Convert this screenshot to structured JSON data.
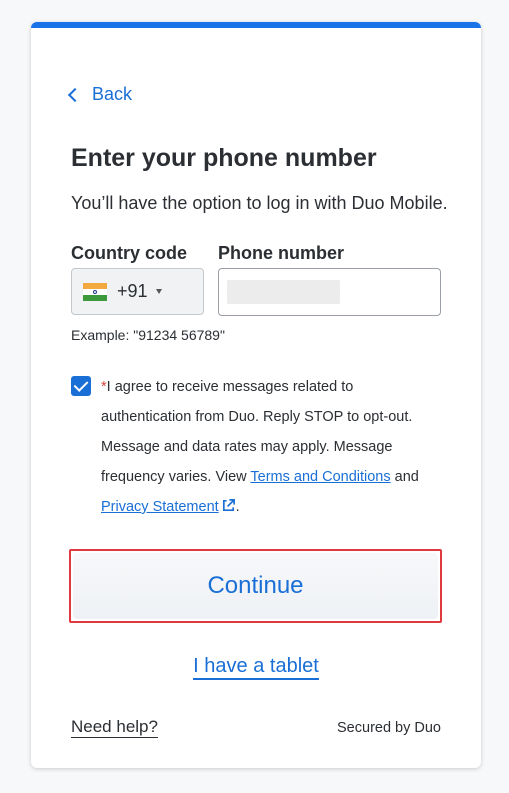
{
  "colors": {
    "accent": "#1a6fd6",
    "top_bar": "#1a73e8",
    "required_asterisk": "#d6453d",
    "highlight_border": "#e0393e"
  },
  "nav": {
    "back_label": "Back",
    "back_icon": "chevron-left-icon"
  },
  "header": {
    "title": "Enter your phone number",
    "subtitle": "You’ll have the option to log in with Duo Mobile."
  },
  "form": {
    "country_label": "Country code",
    "country_flag": "india-flag-icon",
    "country_dial_code": "+91",
    "phone_label": "Phone number",
    "phone_value": "",
    "example": "Example: \"91234 56789\""
  },
  "consent": {
    "checked": true,
    "asterisk": "*",
    "text_1": "I agree to receive messages related to authentication from Duo. Reply STOP to opt-out. Message and data rates may apply. Message frequency varies. View ",
    "terms_link": "Terms and Conditions",
    "text_2": " and ",
    "privacy_link": "Privacy Statement",
    "text_3": "."
  },
  "actions": {
    "continue_label": "Continue",
    "tablet_label": "I have a tablet"
  },
  "footer": {
    "help_label": "Need help?",
    "secured_label": "Secured by Duo"
  }
}
